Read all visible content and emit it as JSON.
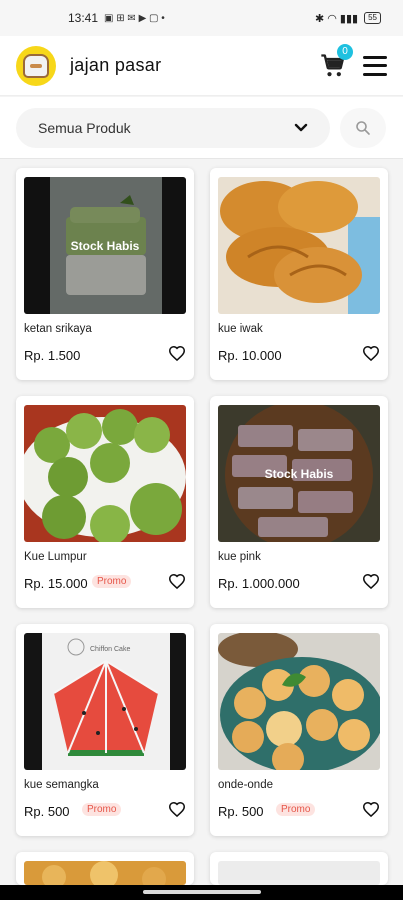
{
  "status_bar": {
    "time": "13:41",
    "left_icons": "▣ ⊞ ✉ ▶ ▢ •",
    "right_icons": "✱ ◠ ▮▮▮",
    "battery": "55"
  },
  "header": {
    "app_name": "jajan pasar",
    "cart_count": "0",
    "cart_icon": "cart-icon",
    "menu_icon": "hamburger-menu-icon"
  },
  "filter": {
    "selected_category": "Semua Produk",
    "dropdown_icon": "chevron-down-icon",
    "search_icon": "search-icon"
  },
  "products": [
    {
      "name": "ketan srikaya",
      "price": "Rp. 1.500",
      "stock_label": "Stock Habis",
      "promo": ""
    },
    {
      "name": "kue iwak",
      "price": "Rp. 10.000",
      "stock_label": "",
      "promo": ""
    },
    {
      "name": "Kue Lumpur",
      "price": "Rp. 15.000",
      "stock_label": "",
      "promo": "Promo"
    },
    {
      "name": "kue pink",
      "price": "Rp. 1.000.000",
      "stock_label": "Stock Habis",
      "promo": ""
    },
    {
      "name": "kue semangka",
      "price": "Rp. 500",
      "stock_label": "",
      "promo": "Promo",
      "image_text": "Chiffon Cake"
    },
    {
      "name": "onde-onde",
      "price": "Rp. 500",
      "stock_label": "",
      "promo": "Promo"
    }
  ],
  "colors": {
    "logo_yellow": "#f7d719",
    "badge_cyan": "#1fc1e0",
    "promo_text": "#e6574a",
    "promo_bg": "#fde3e0"
  }
}
